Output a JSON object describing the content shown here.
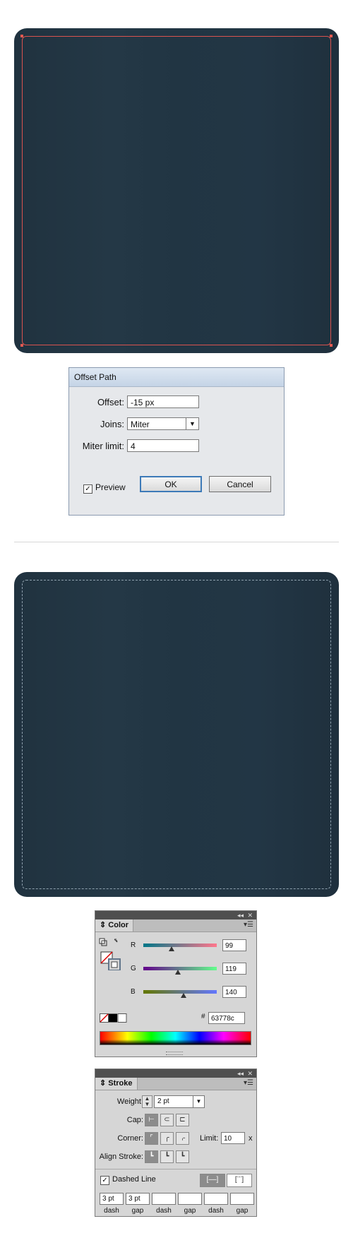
{
  "dialog": {
    "title": "Offset Path",
    "offset_label": "Offset:",
    "offset_value": "-15 px",
    "joins_label": "Joins:",
    "joins_value": "Miter",
    "miter_label": "Miter limit:",
    "miter_value": "4",
    "preview_label": "Preview",
    "preview_checked": true,
    "ok": "OK",
    "cancel": "Cancel"
  },
  "color_panel": {
    "tab": "Color",
    "r_label": "R",
    "g_label": "G",
    "b_label": "B",
    "r_value": "99",
    "g_value": "119",
    "b_value": "140",
    "hex_label": "#",
    "hex_value": "63778c",
    "r": 99,
    "g": 119,
    "b": 140
  },
  "stroke_panel": {
    "tab": "Stroke",
    "weight_label": "Weight:",
    "weight_value": "2 pt",
    "cap_label": "Cap:",
    "corner_label": "Corner:",
    "limit_label": "Limit:",
    "limit_value": "10",
    "limit_unit": "x",
    "align_label": "Align Stroke:",
    "dashed_label": "Dashed Line",
    "dashed_checked": true,
    "dash_values": [
      "3 pt",
      "3 pt",
      "",
      "",
      "",
      ""
    ],
    "dash_labels": [
      "dash",
      "gap",
      "dash",
      "gap",
      "dash",
      "gap"
    ]
  },
  "colors": {
    "artboard": "#223645",
    "offset_path": "#d9534f",
    "dashed_stroke": "#63778c"
  }
}
